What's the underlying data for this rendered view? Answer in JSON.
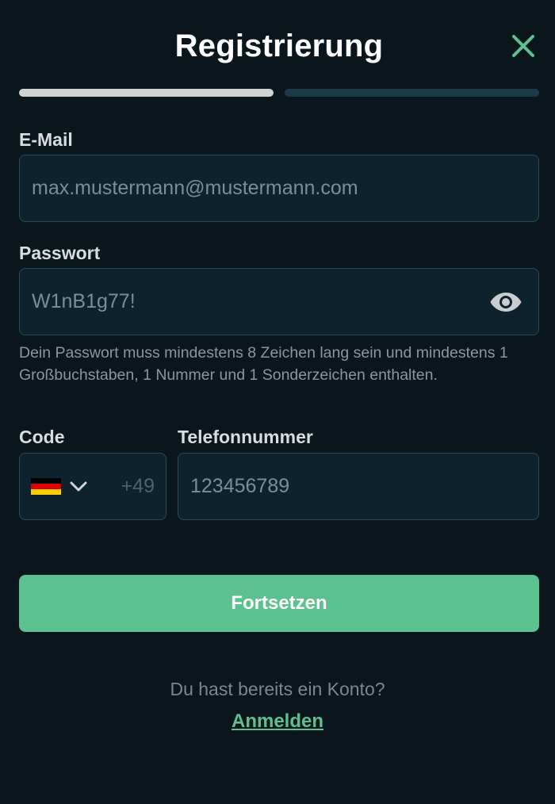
{
  "header": {
    "title": "Registrierung",
    "close_icon": "close-icon"
  },
  "progress": {
    "current_step": 1,
    "total_steps": 2
  },
  "email": {
    "label": "E-Mail",
    "placeholder": "max.mustermann@mustermann.com"
  },
  "password": {
    "label": "Passwort",
    "value": "W1nB1g77!",
    "toggle_icon": "eye-icon",
    "hint": "Dein Passwort muss mindestens 8 Zeichen lang sein und mindestens 1 Großbuchstaben, 1 Nummer und 1 Sonderzeichen enthalten."
  },
  "phone": {
    "code_label": "Code",
    "number_label": "Telefonnummer",
    "country_icon": "germany-flag-icon",
    "dial_code": "+49",
    "placeholder": "123456789"
  },
  "actions": {
    "continue_label": "Fortsetzen"
  },
  "footer": {
    "question": "Du hast bereits ein Konto?",
    "login_label": "Anmelden"
  },
  "colors": {
    "background": "#0b151c",
    "accent": "#5cc18e",
    "progress_active": "#d0d3d4",
    "progress_inactive": "#1d3a49",
    "field_background": "#0e222d",
    "field_border": "#2c4856"
  }
}
